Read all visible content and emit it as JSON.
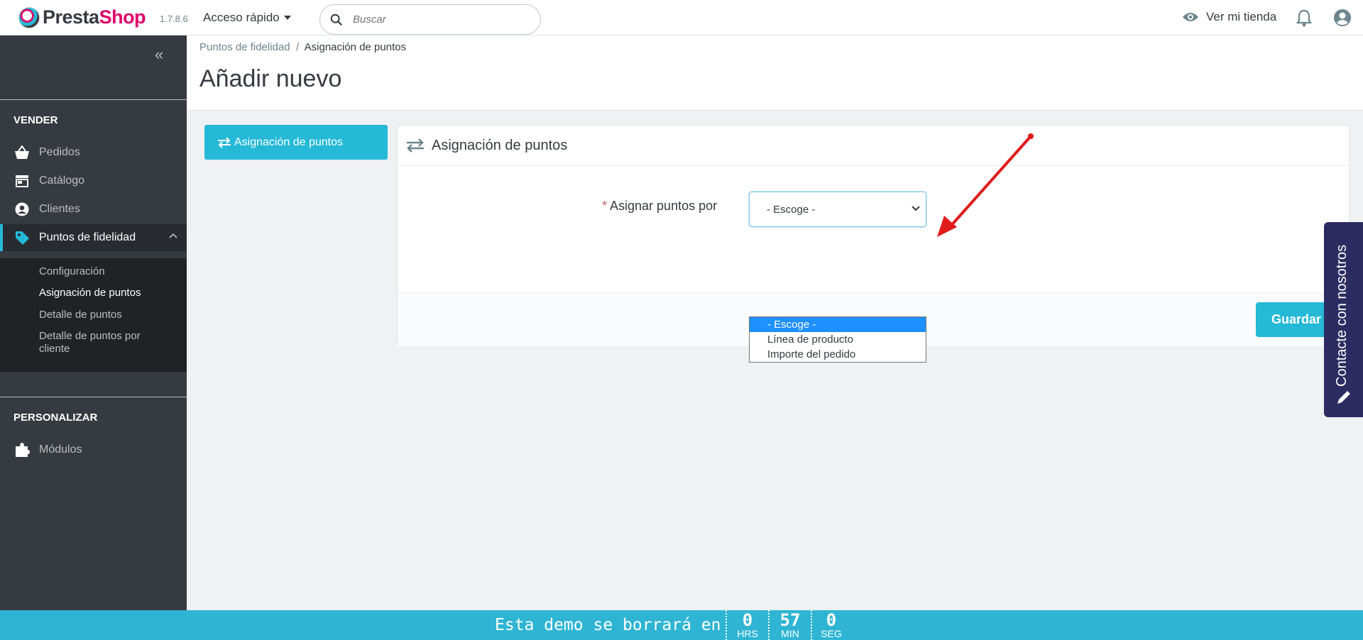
{
  "header": {
    "logo_text_1": "Presta",
    "logo_text_2": "Shop",
    "version": "1.7.8.6",
    "quick_access": "Acceso rápido",
    "search_placeholder": "Buscar",
    "view_store": "Ver mi tienda"
  },
  "sidebar": {
    "section_sell": "VENDER",
    "items": [
      {
        "label": "Pedidos",
        "icon": "basket-icon"
      },
      {
        "label": "Catálogo",
        "icon": "store-icon"
      },
      {
        "label": "Clientes",
        "icon": "user-circle-icon"
      },
      {
        "label": "Puntos de fidelidad",
        "icon": "tag-icon"
      }
    ],
    "submenu": [
      {
        "label": "Configuración"
      },
      {
        "label": "Asignación de puntos"
      },
      {
        "label": "Detalle de puntos"
      },
      {
        "label": "Detalle de puntos por cliente"
      }
    ],
    "section_customize": "PERSONALIZAR",
    "modules": "Módulos"
  },
  "page": {
    "breadcrumb_parent": "Puntos de fidelidad",
    "breadcrumb_sep": "/",
    "breadcrumb_current": "Asignación de puntos",
    "title": "Añadir nuevo"
  },
  "tab": {
    "label": "Asignación de puntos"
  },
  "panel": {
    "title": "Asignación de puntos",
    "required_mark": "*",
    "field_label": "Asignar puntos por",
    "select_value": "- Escoge -",
    "options": [
      "- Escoge -",
      "Línea de producto",
      "Importe del pedido"
    ],
    "save_label": "Guardar"
  },
  "contact_tab": "Contacte con nosotros",
  "demo_bar": {
    "text": "Esta demo se borrará en",
    "hours": "0",
    "hours_unit": "HRS",
    "minutes": "57",
    "minutes_unit": "MIN",
    "seconds": "0",
    "seconds_unit": "SEG"
  },
  "colors": {
    "accent": "#25b9d7",
    "sidebar": "#363a41",
    "brand_pink": "#df0067",
    "annotation_arrow": "#e01b1b"
  }
}
